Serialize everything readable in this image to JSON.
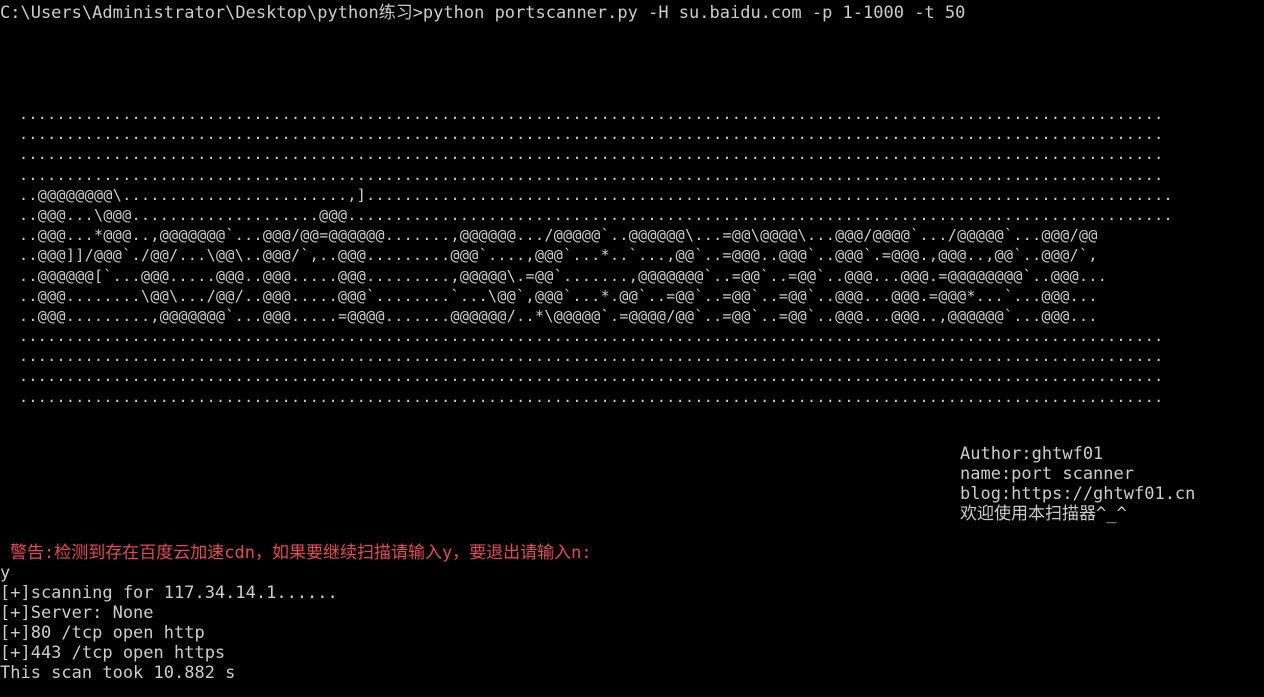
{
  "terminal": {
    "prompt_line": "C:\\Users\\Administrator\\Desktop\\python练习>python portscanner.py -H su.baidu.com -p 1-1000 -t 50",
    "banner": [
      "..........................................................................................................................",
      "..........................................................................................................................",
      "..........................................................................................................................",
      "..........................................................................................................................",
      "..@@@@@@@@\\........................,]......................................................................................",
      "..@@@...\\@@@....................@@@........................................................................................",
      "..@@@...*@@@..,@@@@@@@`...@@@/@@=@@@@@@.......,@@@@@@.../@@@@@`..@@@@@@\\...=@@\\@@@@\\...@@@/@@@@`.../@@@@@`...@@@/@@",
      "..@@@]]/@@@`./@@/...\\@@\\..@@@/`,..@@@.........@@@`....,@@@`...*..`...,@@`..=@@@..@@@`..@@@`.=@@@.,@@@..,@@`..@@@/`,",
      "..@@@@@@[`...@@@.....@@@..@@@.....@@@.........,@@@@@\\.=@@`.......,@@@@@@@`..=@@`..=@@`..@@@...@@@.=@@@@@@@@`..@@@...",
      "..@@@........\\@@\\.../@@/..@@@.....@@@`........`...\\@@`,@@@`...*.@@`..=@@`..=@@`..=@@`..@@@...@@@.=@@@*...`...@@@...",
      "..@@@.........,@@@@@@@`...@@@.....=@@@@.......@@@@@@/..*\\@@@@@`.=@@@@/@@`..=@@`..=@@`..@@@...@@@..,@@@@@@`...@@@...",
      "..........................................................................................................................",
      "..........................................................................................................................",
      "..........................................................................................................................",
      ".........................................................................................................................."
    ],
    "info": {
      "author": "Author:ghtwf01",
      "name": "name:port scanner",
      "blog": "blog:https://ghtwf01.cn",
      "welcome": "欢迎使用本扫描器^_^"
    },
    "warning": "警告:检测到存在百度云加速cdn，如果要继续扫描请输入y，要退出请输入n:",
    "answer": "y",
    "output": [
      "[+]scanning for 117.34.14.1......",
      "[+]Server: None",
      "[+]80 /tcp open http",
      "[+]443 /tcp open https",
      "This scan took 10.882 s"
    ],
    "colors": {
      "background": "#000000",
      "text": "#cccccc",
      "warning": "#e74856"
    }
  }
}
